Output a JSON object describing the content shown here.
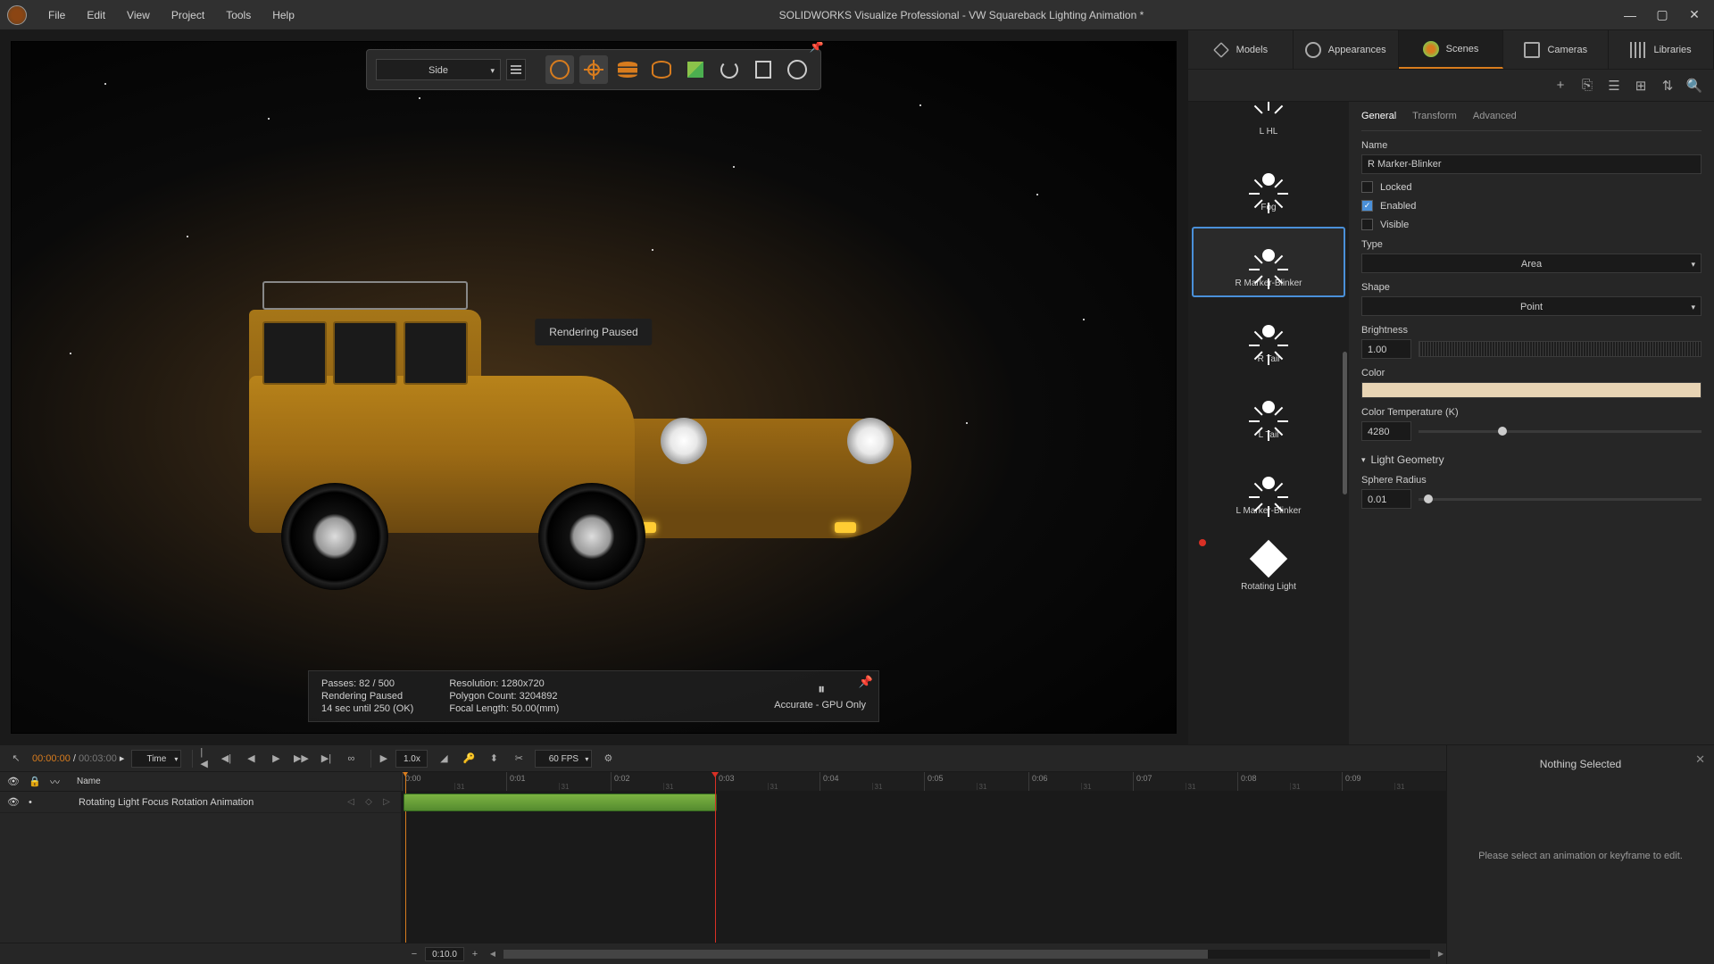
{
  "window": {
    "title": "SOLIDWORKS Visualize Professional - VW Squareback Lighting Animation *"
  },
  "menu": [
    "File",
    "Edit",
    "View",
    "Project",
    "Tools",
    "Help"
  ],
  "viewport": {
    "camera_view": "Side",
    "render_status": "Rendering Paused",
    "stats": {
      "passes": "Passes: 82 / 500",
      "status": "Rendering Paused",
      "eta": "14 sec until 250 (OK)",
      "resolution": "Resolution: 1280x720",
      "polycount": "Polygon Count: 3204892",
      "focal": "Focal Length: 50.00(mm)",
      "mode": "Accurate - GPU Only"
    }
  },
  "tabs": {
    "models": "Models",
    "appearances": "Appearances",
    "scenes": "Scenes",
    "cameras": "Cameras",
    "libraries": "Libraries"
  },
  "scene_items": {
    "lhl": "L HL",
    "fog": "Fog",
    "rmarker": "R Marker-Blinker",
    "rtail": "R Tail",
    "ltail": "L Tail",
    "lmarker": "L Marker-Blinker",
    "rotating": "Rotating Light"
  },
  "props": {
    "tabs": {
      "general": "General",
      "transform": "Transform",
      "advanced": "Advanced"
    },
    "name_label": "Name",
    "name_value": "R Marker-Blinker",
    "locked": "Locked",
    "enabled": "Enabled",
    "visible": "Visible",
    "type_label": "Type",
    "type_value": "Area",
    "shape_label": "Shape",
    "shape_value": "Point",
    "brightness_label": "Brightness",
    "brightness_value": "1.00",
    "color_label": "Color",
    "temp_label": "Color Temperature (K)",
    "temp_value": "4280",
    "geom_label": "Light Geometry",
    "radius_label": "Sphere Radius",
    "radius_value": "0.01"
  },
  "timeline": {
    "current": "00:00:00",
    "duration": "00:03:00",
    "mode": "Time",
    "speed": "1.0x",
    "fps": "60 FPS",
    "header_name": "Name",
    "track_name": "Rotating Light Focus Rotation Animation",
    "ticks": [
      "0:00",
      "0:01",
      "0:02",
      "0:03",
      "0:04",
      "0:05",
      "0:06",
      "0:07",
      "0:08",
      "0:09"
    ],
    "zoom": "0:10.0"
  },
  "keyframe_panel": {
    "title": "Nothing Selected",
    "message": "Please select an animation or keyframe to edit."
  }
}
